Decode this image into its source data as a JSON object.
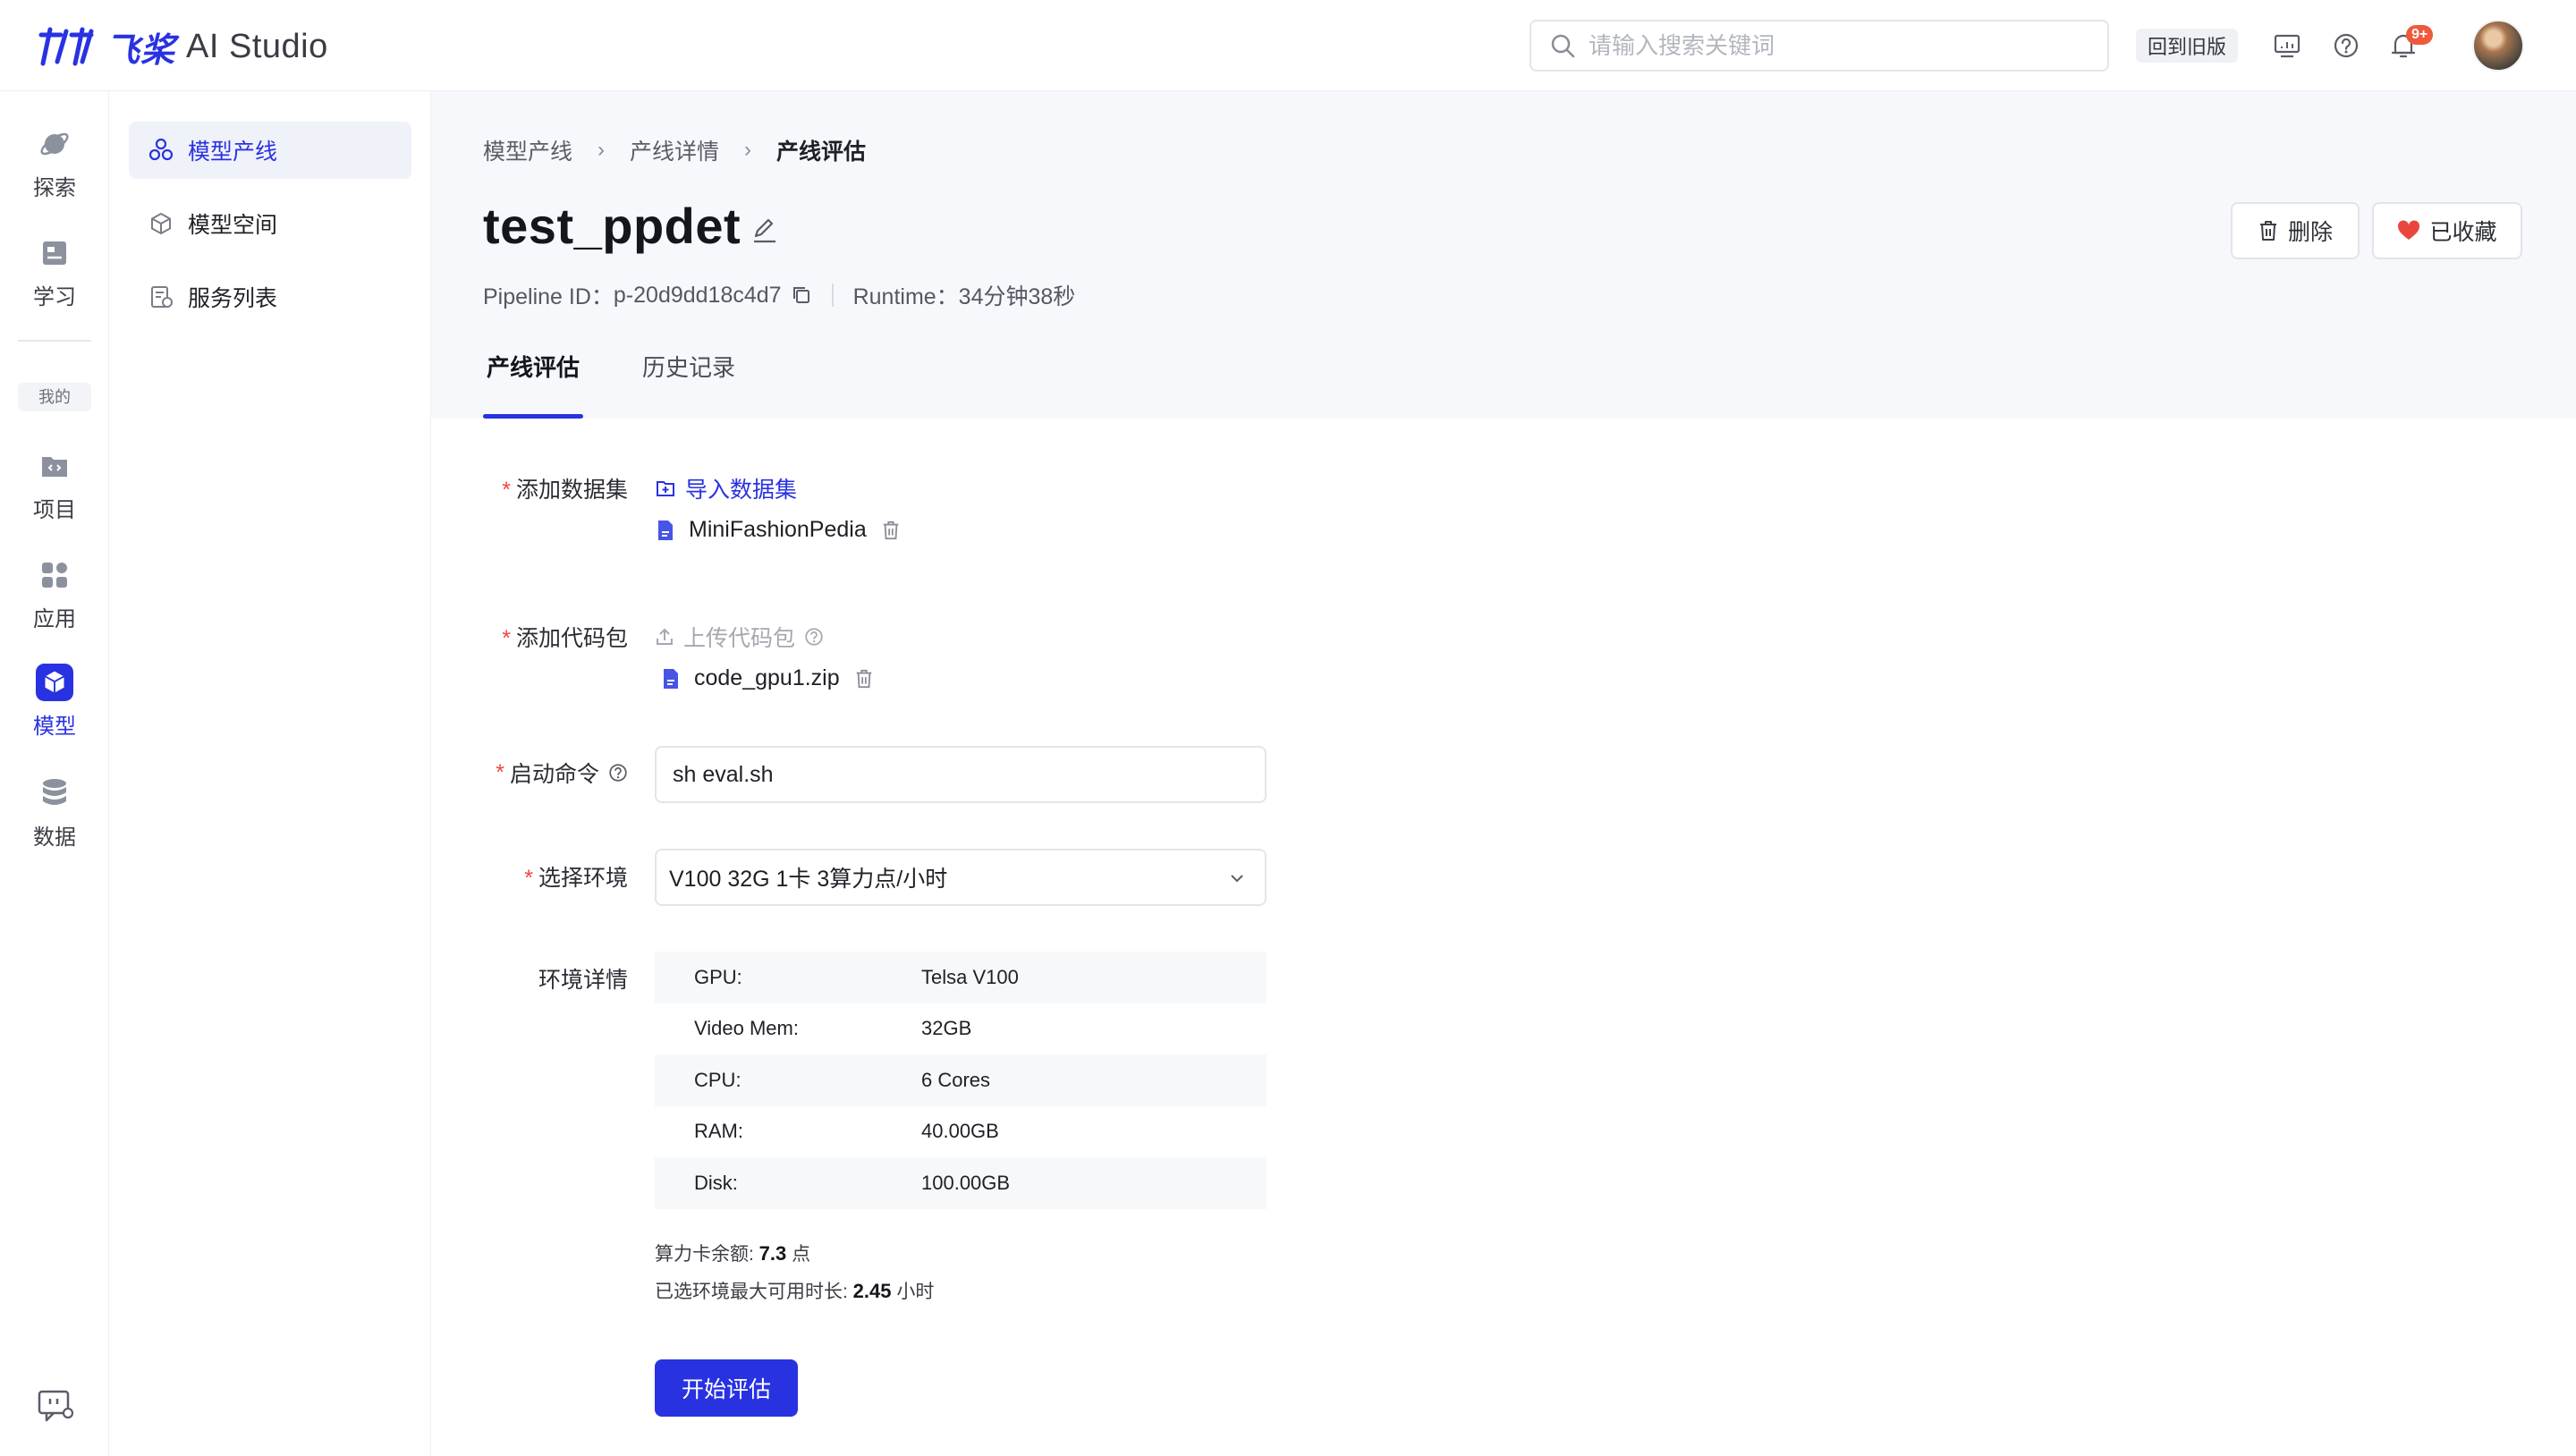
{
  "header": {
    "brand_cn": "飞桨",
    "brand_en": "AI Studio",
    "search_placeholder": "请输入搜索关键词",
    "old_version_label": "回到旧版",
    "notification_count": "9+"
  },
  "rail": {
    "explore": "探索",
    "learn": "学习",
    "mine": "我的",
    "project": "项目",
    "app": "应用",
    "model": "模型",
    "data": "数据"
  },
  "subnav": {
    "items": [
      {
        "label": "模型产线",
        "active": true
      },
      {
        "label": "模型空间",
        "active": false
      },
      {
        "label": "服务列表",
        "active": false
      }
    ]
  },
  "breadcrumb": [
    "模型产线",
    "产线详情",
    "产线评估"
  ],
  "pipeline": {
    "title": "test_ppdet",
    "id_label": "Pipeline ID：",
    "id_value": "p-20d9dd18c4d7",
    "runtime_label": "Runtime：",
    "runtime_value": "34分钟38秒",
    "delete_label": "删除",
    "favorite_label": "已收藏"
  },
  "tabs": [
    {
      "label": "产线评估",
      "active": true
    },
    {
      "label": "历史记录",
      "active": false
    }
  ],
  "form": {
    "dataset_label": "添加数据集",
    "dataset_action": "导入数据集",
    "dataset_file": "MiniFashionPedia",
    "code_label": "添加代码包",
    "code_action": "上传代码包",
    "code_file": "code_gpu1.zip",
    "command_label": "启动命令",
    "command_value": "sh eval.sh",
    "env_label": "选择环境",
    "env_value": "V100 32G 1卡 3算力点/小时",
    "env_detail_label": "环境详情",
    "env_details": [
      {
        "key": "GPU:",
        "value": "Telsa V100"
      },
      {
        "key": "Video Mem:",
        "value": "32GB"
      },
      {
        "key": "CPU:",
        "value": "6 Cores"
      },
      {
        "key": "RAM:",
        "value": "40.00GB"
      },
      {
        "key": "Disk:",
        "value": "100.00GB"
      }
    ],
    "balance_label": "算力卡余额: ",
    "balance_value": "7.3",
    "balance_unit": " 点",
    "max_time_label": "已选环境最大可用时长: ",
    "max_time_value": "2.45",
    "max_time_unit": " 小时",
    "submit_label": "开始评估"
  },
  "colors": {
    "accent": "#2932e1",
    "required": "#f0483c",
    "favorite": "#e8473e"
  }
}
